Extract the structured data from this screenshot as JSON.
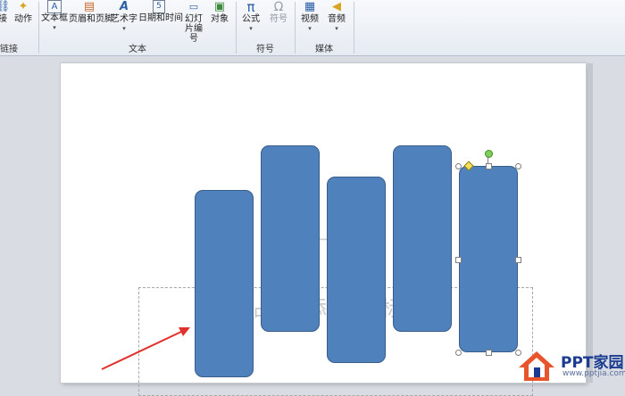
{
  "ribbon": {
    "buttons": [
      {
        "name": "hyperlink",
        "label": "接",
        "icon": "link-icon",
        "glyph": "🔗",
        "dropdown": ""
      },
      {
        "name": "action",
        "label": "动作",
        "icon": "star-action-icon",
        "glyph": "★",
        "dropdown": ""
      },
      {
        "name": "textbox",
        "label": "文本框",
        "icon": "textbox-icon",
        "glyph": "A",
        "dropdown": "▾"
      },
      {
        "name": "header-footer",
        "label": "页眉和页脚",
        "icon": "header-footer-icon",
        "glyph": "▤",
        "dropdown": ""
      },
      {
        "name": "wordart",
        "label": "艺术字",
        "icon": "wordart-icon",
        "glyph": "A",
        "dropdown": "▾"
      },
      {
        "name": "datetime",
        "label": "日期和时间",
        "icon": "calendar-icon",
        "glyph": "5",
        "dropdown": ""
      },
      {
        "name": "slide-number",
        "label": "幻灯片编号",
        "icon": "slide-number-icon",
        "glyph": "#",
        "dropdown": ""
      },
      {
        "name": "object",
        "label": "对象",
        "icon": "object-icon",
        "glyph": "▣",
        "dropdown": ""
      },
      {
        "name": "equation",
        "label": "公式",
        "icon": "pi-icon",
        "glyph": "π",
        "dropdown": "▾"
      },
      {
        "name": "symbol",
        "label": "符号",
        "icon": "omega-icon",
        "glyph": "Ω",
        "dropdown": ""
      },
      {
        "name": "video",
        "label": "视频",
        "icon": "film-icon",
        "glyph": "🎞",
        "dropdown": "▾"
      },
      {
        "name": "audio",
        "label": "音频",
        "icon": "speaker-icon",
        "glyph": "🔊",
        "dropdown": "▾"
      }
    ],
    "groups": {
      "links": "链接",
      "text": "文本",
      "symbols": "符号",
      "media": "媒体"
    }
  },
  "slide": {
    "placeholder_text_1": "占",
    "placeholder_text_2": "添",
    "placeholder_text_3": "标",
    "placeholder_text_4": "一"
  },
  "shapes": {
    "fill": "#4f81bd",
    "stroke": "#385d8a",
    "count": 5,
    "selected_index": 4
  },
  "annotation": {
    "arrow_color": "#e0322d"
  },
  "logo": {
    "title": "PPT家园",
    "subtitle": "www.pptjia.com"
  }
}
